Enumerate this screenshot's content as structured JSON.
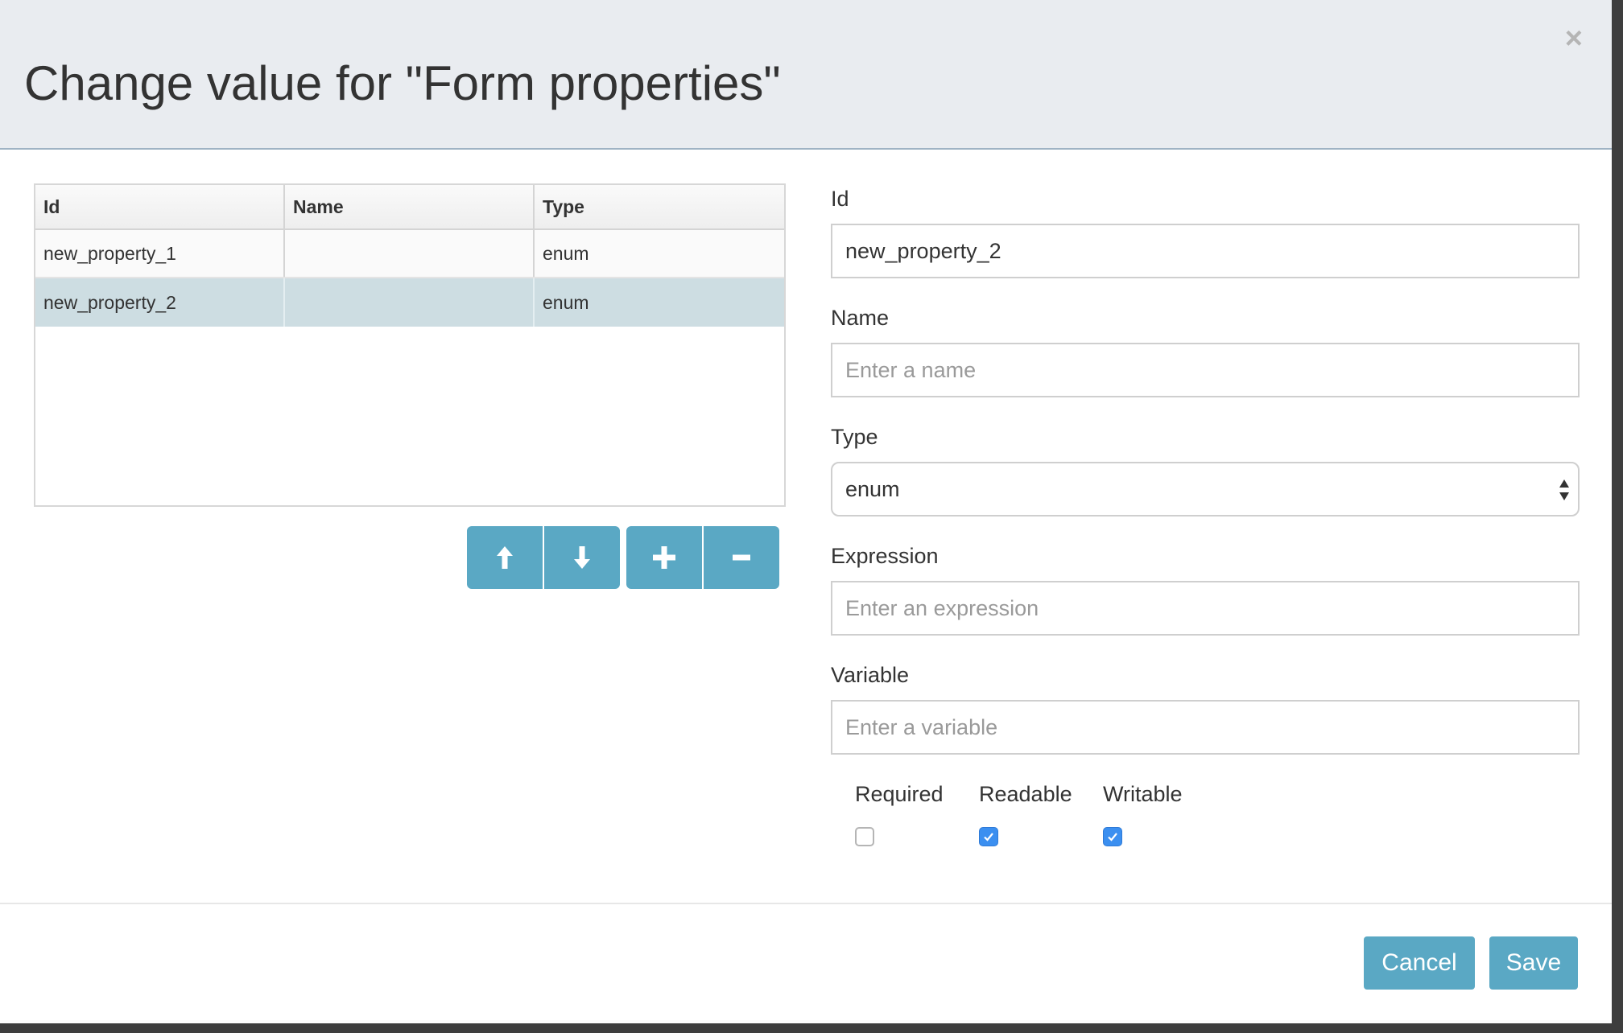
{
  "dialog": {
    "title": "Change value for \"Form properties\"",
    "close_glyph": "×"
  },
  "table": {
    "columns": [
      "Id",
      "Name",
      "Type"
    ],
    "rows": [
      {
        "id": "new_property_1",
        "name": "",
        "type": "enum",
        "selected": false
      },
      {
        "id": "new_property_2",
        "name": "",
        "type": "enum",
        "selected": true
      }
    ]
  },
  "actions": {
    "move_up_icon": "arrow-up-icon",
    "move_down_icon": "arrow-down-icon",
    "add_icon": "plus-icon",
    "remove_icon": "minus-icon",
    "color": "#5aa8c4"
  },
  "form": {
    "id": {
      "label": "Id",
      "value": "new_property_2",
      "placeholder": ""
    },
    "name": {
      "label": "Name",
      "value": "",
      "placeholder": "Enter a name"
    },
    "type": {
      "label": "Type",
      "value": "enum"
    },
    "expression": {
      "label": "Expression",
      "value": "",
      "placeholder": "Enter an expression"
    },
    "variable": {
      "label": "Variable",
      "value": "",
      "placeholder": "Enter a variable"
    },
    "required": {
      "label": "Required",
      "checked": false
    },
    "readable": {
      "label": "Readable",
      "checked": true
    },
    "writable": {
      "label": "Writable",
      "checked": true
    }
  },
  "footer": {
    "cancel_label": "Cancel",
    "save_label": "Save"
  },
  "colors": {
    "accent": "#5aa8c4",
    "header_bg": "#e9ecf0",
    "selected_row": "#cddde2",
    "checkbox_checked": "#3b8ff0"
  }
}
